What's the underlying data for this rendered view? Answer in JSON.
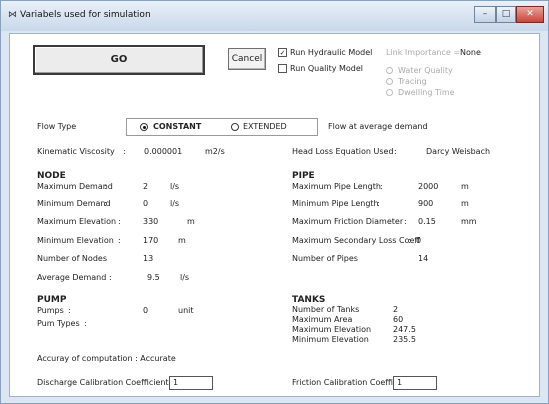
{
  "window": {
    "title": "Variabels used for simulation"
  },
  "actions": {
    "go_label": "GO",
    "cancel_label": "Cancel"
  },
  "options": {
    "run_hydraulic_label": "Run Hydraulic Model",
    "run_hydraulic_checked": true,
    "run_quality_label": "Run Quality Model",
    "run_quality_checked": false,
    "link_importance_label": "Link Importance =",
    "link_importance_value": "None",
    "quality_options": [
      "Water Quality",
      "Tracing",
      "Dwelling Time"
    ]
  },
  "flow": {
    "type_label": "Flow Type",
    "constant_label": "CONSTANT",
    "extended_label": "EXTENDED",
    "selected": "CONSTANT",
    "note": "Flow at average demand"
  },
  "viscosity": {
    "label": "Kinematic Viscosity",
    "value": "0.000001",
    "unit": "m2/s"
  },
  "headloss": {
    "label": "Head Loss Equation Used",
    "value": "Darcy Weisbach"
  },
  "node": {
    "title": "NODE",
    "rows": [
      {
        "label": "Maximum Demand",
        "value": "2",
        "unit": "l/s"
      },
      {
        "label": "Minimum Demand",
        "value": "0",
        "unit": "l/s"
      },
      {
        "label": "Maximum Elevation",
        "value": "330",
        "unit": "m"
      },
      {
        "label": "Minimum Elevation",
        "value": "170",
        "unit": "m"
      },
      {
        "label": "Number of Nodes",
        "value": "13",
        "unit": ""
      },
      {
        "label": "Average Demand",
        "value": "9.5",
        "unit": "l/s"
      }
    ]
  },
  "pipe": {
    "title": "PIPE",
    "rows": [
      {
        "label": "Maximum Pipe Length",
        "value": "2000",
        "unit": "m"
      },
      {
        "label": "Minimum Pipe Length",
        "value": "900",
        "unit": "m"
      },
      {
        "label": "Maximum Friction Diameter",
        "value": "0.15",
        "unit": "mm"
      },
      {
        "label": "Maximum Secondary Loss Coeff",
        "value": "0",
        "unit": ""
      },
      {
        "label": "Number of Pipes",
        "value": "14",
        "unit": ""
      }
    ]
  },
  "pump": {
    "title": "PUMP",
    "pumps_label": "Pumps",
    "pumps_value": "0",
    "pumps_unit": "unit",
    "types_label": "Pum Types"
  },
  "tanks": {
    "title": "TANKS",
    "rows": [
      {
        "label": "Number of Tanks",
        "value": "2"
      },
      {
        "label": "Maximum Area",
        "value": "60"
      },
      {
        "label": "Maximum Elevation",
        "value": "247.5"
      },
      {
        "label": "Minimum Elevation",
        "value": "235.5"
      }
    ]
  },
  "accuracy": {
    "text": "Accuray of computation : Accurate"
  },
  "calibration": {
    "discharge_label": "Discharge Calibration Coefficient",
    "discharge_value": "1",
    "friction_label": "Friction Calibration Coefficient",
    "friction_value": "1"
  }
}
